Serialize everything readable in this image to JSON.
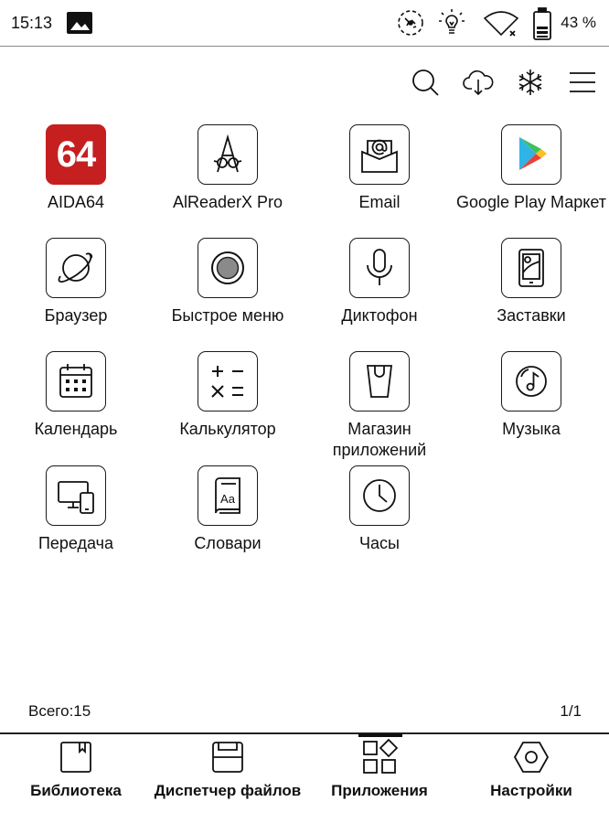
{
  "status_bar": {
    "time": "15:13",
    "battery_percent": "43 %",
    "icons": [
      "image-icon",
      "sync-icon",
      "frontlight-icon",
      "wifi-off-icon",
      "battery-icon"
    ]
  },
  "toolbar": {
    "icons": [
      "search-icon",
      "cloud-download-icon",
      "snowflake-icon",
      "menu-icon"
    ]
  },
  "apps": [
    {
      "label": "AIDA64",
      "icon": "aida64-icon",
      "logo_text": "64"
    },
    {
      "label": "AlReaderX Pro",
      "icon": "alreader-icon"
    },
    {
      "label": "Email",
      "icon": "email-icon"
    },
    {
      "label": "Google Play Маркет",
      "icon": "google-play-icon"
    },
    {
      "label": "Браузер",
      "icon": "browser-icon"
    },
    {
      "label": "Быстрое меню",
      "icon": "quick-menu-icon"
    },
    {
      "label": "Диктофон",
      "icon": "microphone-icon"
    },
    {
      "label": "Заставки",
      "icon": "screensaver-icon"
    },
    {
      "label": "Календарь",
      "icon": "calendar-icon"
    },
    {
      "label": "Калькулятор",
      "icon": "calculator-icon"
    },
    {
      "label": "Магазин приложений",
      "icon": "app-store-icon"
    },
    {
      "label": "Музыка",
      "icon": "music-icon"
    },
    {
      "label": "Передача",
      "icon": "transfer-icon"
    },
    {
      "label": "Словари",
      "icon": "dictionary-icon",
      "glyph": "Aa"
    },
    {
      "label": "Часы",
      "icon": "clock-icon"
    }
  ],
  "footer": {
    "total": "Всего:15",
    "page": "1/1"
  },
  "bottom_nav": [
    {
      "label": "Библиотека",
      "icon": "library-icon",
      "active": false
    },
    {
      "label": "Диспетчер файлов",
      "icon": "file-manager-icon",
      "active": false
    },
    {
      "label": "Приложения",
      "icon": "apps-icon",
      "active": true
    },
    {
      "label": "Настройки",
      "icon": "settings-icon",
      "active": false
    }
  ],
  "colors": {
    "aida_red": "#c51f1f",
    "foreground": "#111111",
    "background": "#ffffff"
  }
}
